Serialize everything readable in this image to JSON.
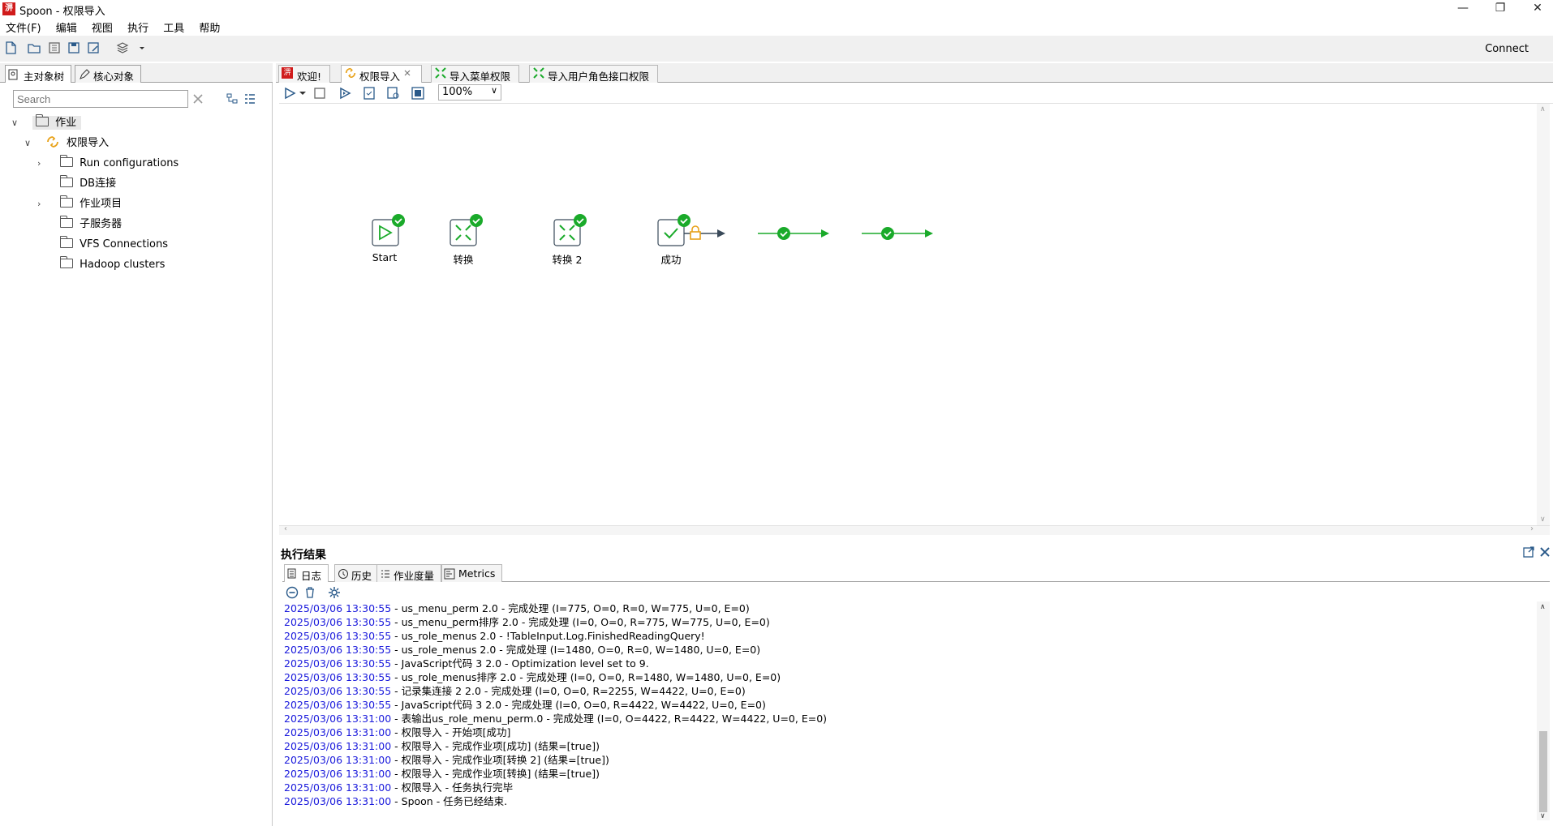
{
  "window": {
    "title": "Spoon - 权限导入",
    "icon_text": "淠"
  },
  "menu": [
    "文件(F)",
    "编辑",
    "视图",
    "执行",
    "工具",
    "帮助"
  ],
  "toolbar": {
    "connect_label": "Connect"
  },
  "left_panel": {
    "tabs": [
      "主对象树",
      "核心对象"
    ],
    "search_placeholder": "Search",
    "tree": {
      "root": "作业",
      "job": "权限导入",
      "children": [
        "Run configurations",
        "DB连接",
        "作业项目",
        "子服务器",
        "VFS Connections",
        "Hadoop clusters"
      ]
    }
  },
  "editor_tabs": [
    "欢迎!",
    "权限导入",
    "导入菜单权限",
    "导入用户角色接口权限"
  ],
  "canvas": {
    "zoom": "100%",
    "nodes": [
      "Start",
      "转换",
      "转换 2",
      "成功"
    ]
  },
  "results": {
    "title": "执行结果",
    "tabs": [
      "日志",
      "历史",
      "作业度量",
      "Metrics"
    ],
    "log": [
      {
        "ts": "2025/03/06 13:30:55",
        "msg": " - us_menu_perm 2.0 - 完成处理 (I=775, O=0, R=0, W=775, U=0, E=0)"
      },
      {
        "ts": "2025/03/06 13:30:55",
        "msg": " - us_menu_perm排序 2.0 - 完成处理 (I=0, O=0, R=775, W=775, U=0, E=0)"
      },
      {
        "ts": "2025/03/06 13:30:55",
        "msg": " - us_role_menus 2.0 - !TableInput.Log.FinishedReadingQuery!"
      },
      {
        "ts": "2025/03/06 13:30:55",
        "msg": " - us_role_menus 2.0 - 完成处理 (I=1480, O=0, R=0, W=1480, U=0, E=0)"
      },
      {
        "ts": "2025/03/06 13:30:55",
        "msg": " - JavaScript代码 3 2.0 - Optimization level set to 9."
      },
      {
        "ts": "2025/03/06 13:30:55",
        "msg": " - us_role_menus排序 2.0 - 完成处理 (I=0, O=0, R=1480, W=1480, U=0, E=0)"
      },
      {
        "ts": "2025/03/06 13:30:55",
        "msg": " - 记录集连接 2 2.0 - 完成处理 (I=0, O=0, R=2255, W=4422, U=0, E=0)"
      },
      {
        "ts": "2025/03/06 13:30:55",
        "msg": " - JavaScript代码 3 2.0 - 完成处理 (I=0, O=0, R=4422, W=4422, U=0, E=0)"
      },
      {
        "ts": "2025/03/06 13:31:00",
        "msg": " - 表输出us_role_menu_perm.0 - 完成处理 (I=0, O=4422, R=4422, W=4422, U=0, E=0)"
      },
      {
        "ts": "2025/03/06 13:31:00",
        "msg": " - 权限导入 - 开始项[成功]"
      },
      {
        "ts": "2025/03/06 13:31:00",
        "msg": " - 权限导入 - 完成作业项[成功] (结果=[true])"
      },
      {
        "ts": "2025/03/06 13:31:00",
        "msg": " - 权限导入 - 完成作业项[转换 2] (结果=[true])"
      },
      {
        "ts": "2025/03/06 13:31:00",
        "msg": " - 权限导入 - 完成作业项[转换] (结果=[true])"
      },
      {
        "ts": "2025/03/06 13:31:00",
        "msg": " - 权限导入 - 任务执行完毕"
      },
      {
        "ts": "2025/03/06 13:31:00",
        "msg": " - Spoon - 任务已经结束."
      }
    ]
  },
  "colors": {
    "accent_green": "#1aaa2a",
    "hop_arrow": "#3a4a5a",
    "lock": "#e8a21a",
    "log_timestamp": "#1a1adc"
  }
}
